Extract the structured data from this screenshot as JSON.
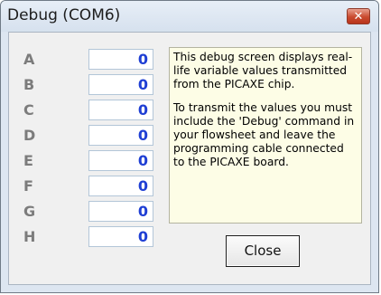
{
  "window": {
    "title": "Debug (COM6)",
    "close_glyph": "✕",
    "close_icon": "close-icon"
  },
  "variables": [
    {
      "name": "A",
      "value": "0"
    },
    {
      "name": "B",
      "value": "0"
    },
    {
      "name": "C",
      "value": "0"
    },
    {
      "name": "D",
      "value": "0"
    },
    {
      "name": "E",
      "value": "0"
    },
    {
      "name": "F",
      "value": "0"
    },
    {
      "name": "G",
      "value": "0"
    },
    {
      "name": "H",
      "value": "0"
    }
  ],
  "info": {
    "paragraph1": "This debug screen displays real-life variable values transmitted from the PICAXE chip.",
    "paragraph2": "To transmit the values you must include the 'Debug' command in your flowsheet and leave the programming cable connected to the PICAXE board."
  },
  "buttons": {
    "close_label": "Close"
  },
  "colors": {
    "value_text": "#1f3fd4",
    "label_text": "#7c7c7c",
    "info_background": "#fdfde6",
    "title_close_button": "#c94a2f"
  }
}
